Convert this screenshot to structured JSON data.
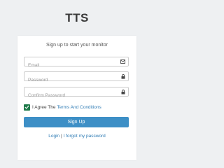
{
  "brand": "TTS",
  "card": {
    "subtitle": "Sign up to start your monitor",
    "fields": {
      "email": {
        "placeholder": "Email",
        "icon": "envelope-icon"
      },
      "password": {
        "placeholder": "Password",
        "icon": "lock-icon"
      },
      "confirm": {
        "placeholder": "Confirm Password",
        "icon": "lock-icon"
      }
    },
    "agree": {
      "checked": true,
      "prefix": "I Agree The",
      "link": "Terms And Conditions"
    },
    "signup_label": "Sign Up",
    "footer": {
      "login": "Login",
      "separator": "|",
      "forgot": "I forgot my password"
    }
  },
  "colors": {
    "primary": "#3d8fc6",
    "checkbox": "#1f7a4a",
    "link": "#2e7bb4",
    "background": "#eef0f2"
  }
}
